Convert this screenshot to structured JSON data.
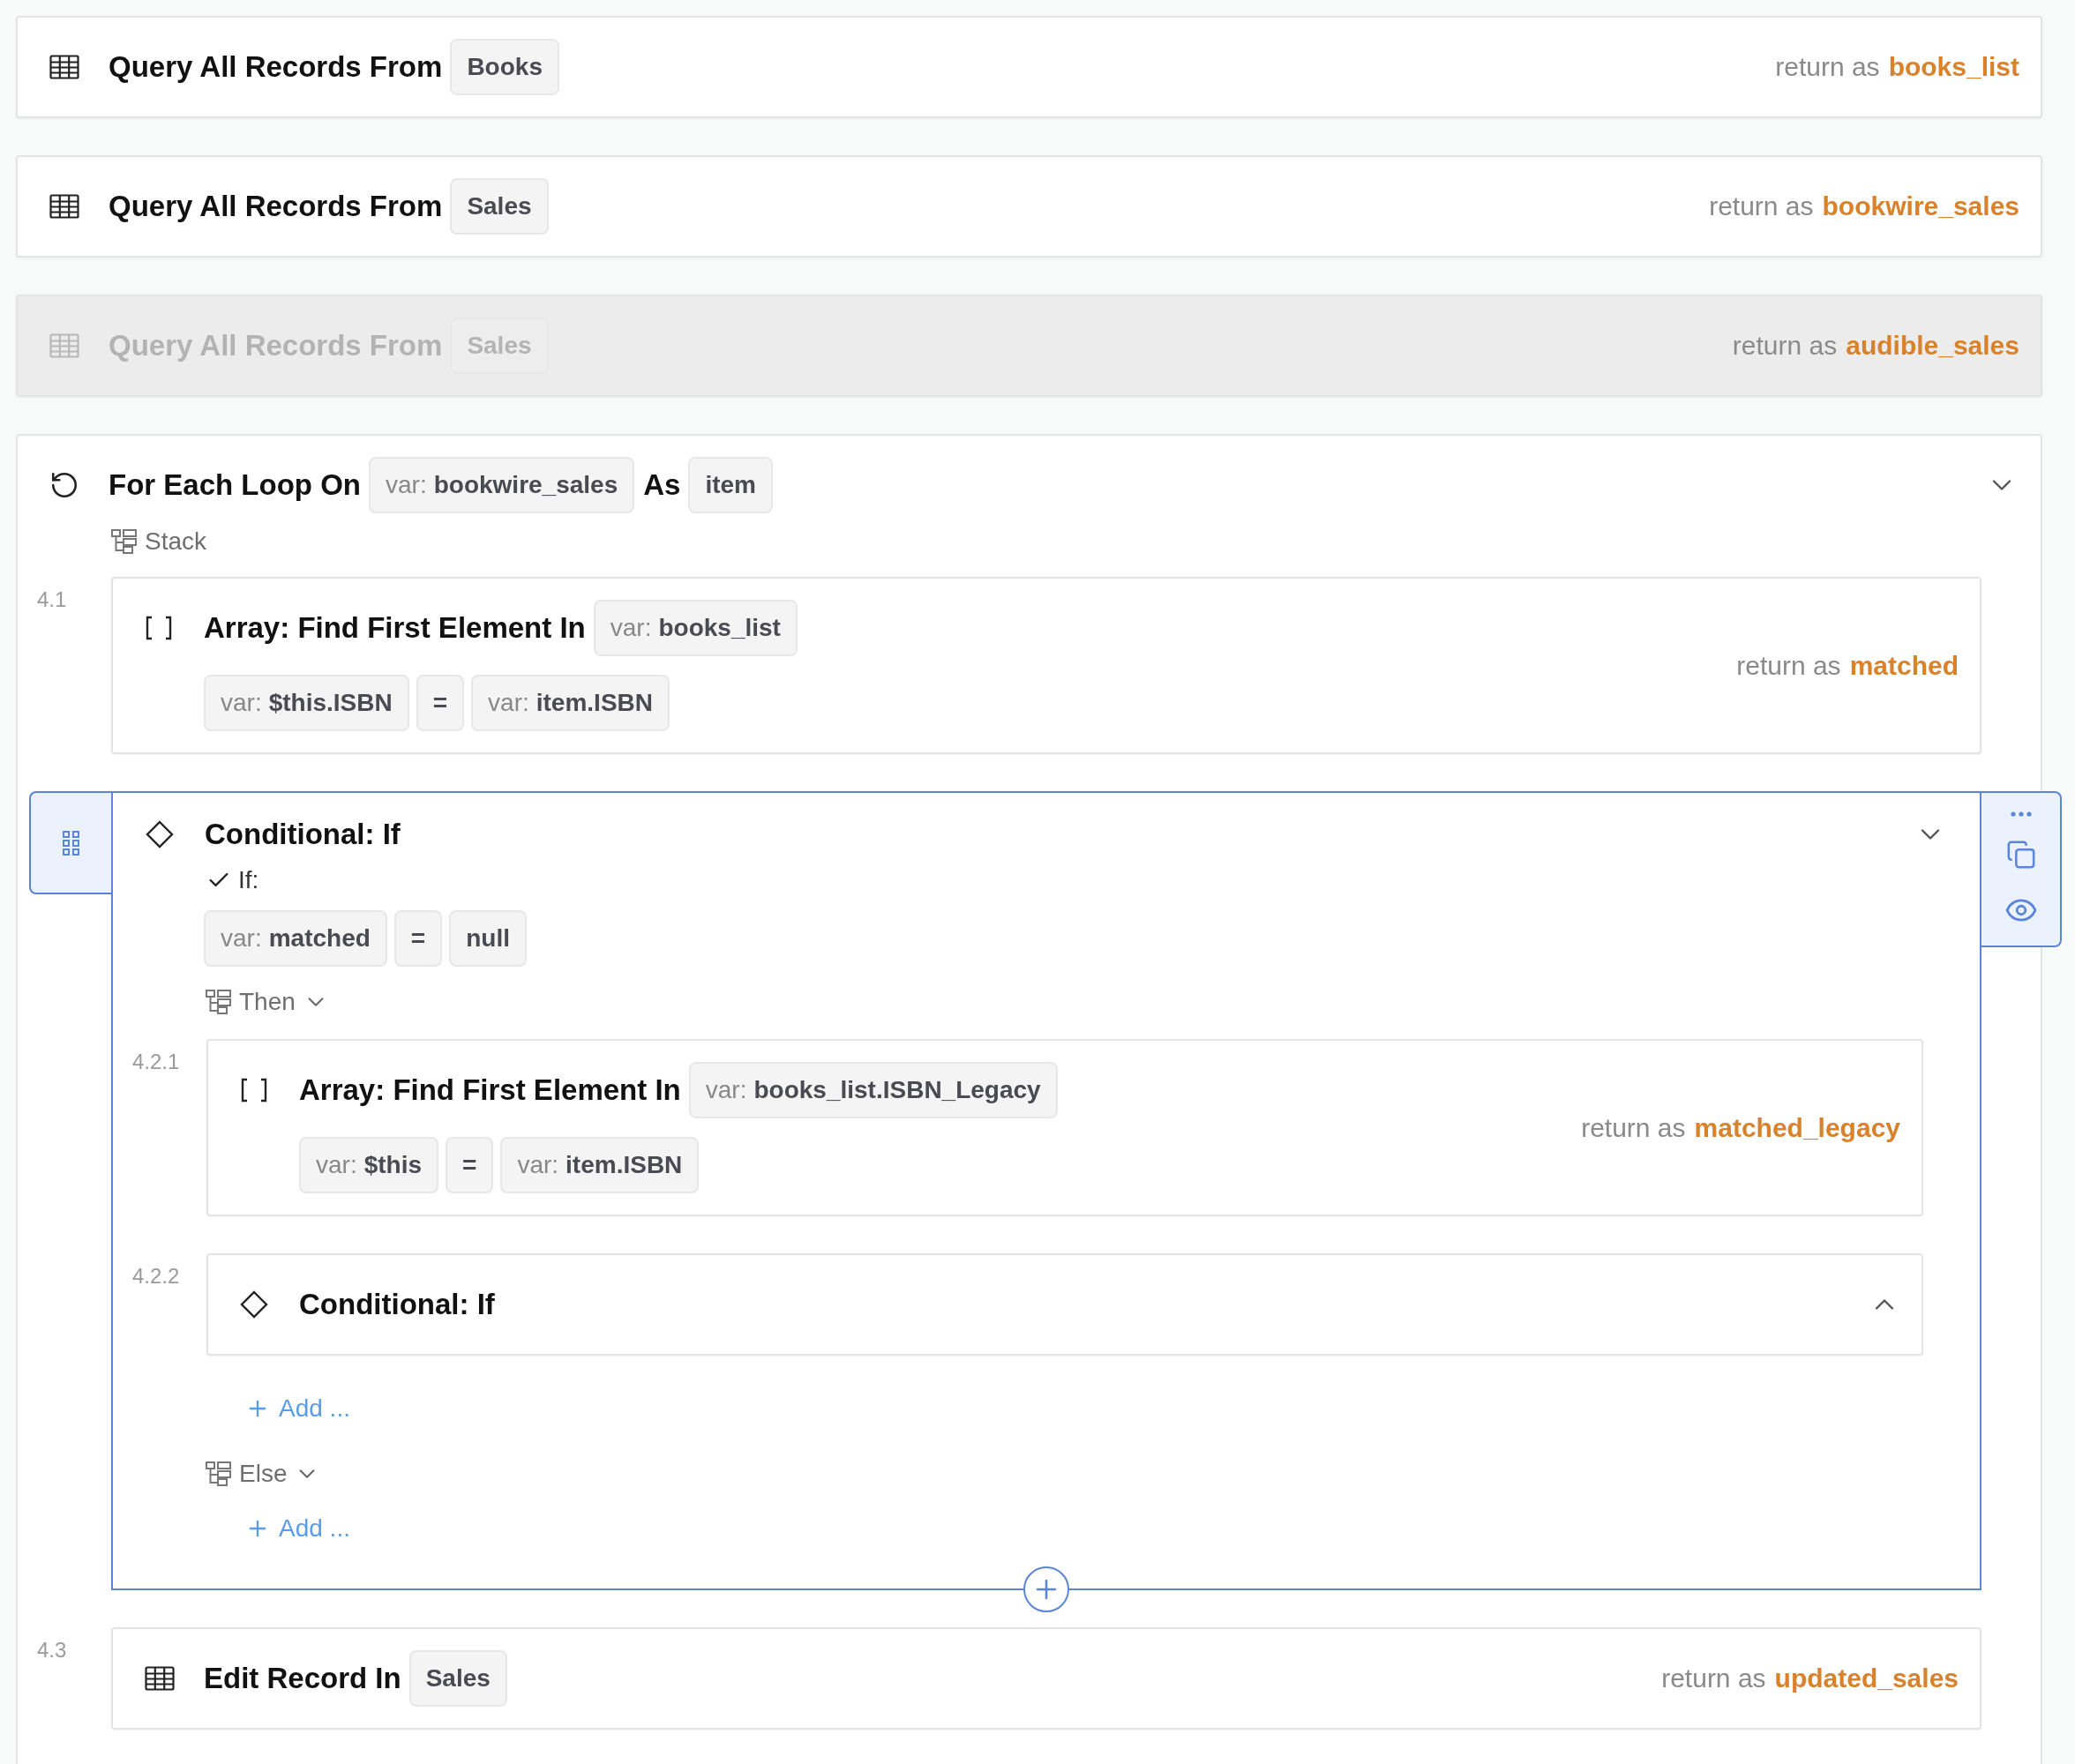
{
  "steps": [
    {
      "kind": "query",
      "disabled": false,
      "title": "Query All Records From",
      "source": {
        "text": "Books"
      },
      "return_label": "return as",
      "return_var": "books_list"
    },
    {
      "kind": "query",
      "disabled": false,
      "title": "Query All Records From",
      "source": {
        "text": "Sales"
      },
      "return_label": "return as",
      "return_var": "bookwire_sales"
    },
    {
      "kind": "query",
      "disabled": true,
      "title": "Query All Records From",
      "source": {
        "text": "Sales"
      },
      "return_label": "return as",
      "return_var": "audible_sales"
    },
    {
      "kind": "loop",
      "disabled": false,
      "expanded": true,
      "title": "For Each Loop On",
      "source": {
        "prefix": "var:",
        "text": "bookwire_sales"
      },
      "as_label": "As",
      "alias": {
        "text": "item"
      },
      "stack_label": "Stack",
      "children": [
        {
          "number": "4.1",
          "kind": "array_find",
          "selected": false,
          "title": "Array: Find First Element In",
          "source": {
            "prefix": "var:",
            "text": "books_list"
          },
          "condition": [
            {
              "prefix": "var:",
              "text": "$this.ISBN"
            },
            {
              "text": "="
            },
            {
              "prefix": "var:",
              "text": "item.ISBN"
            }
          ],
          "return_label": "return as",
          "return_var": "matched"
        },
        {
          "kind": "conditional",
          "selected": true,
          "expanded": true,
          "title": "Conditional: If",
          "if_label": "If:",
          "condition": [
            {
              "prefix": "var:",
              "text": "matched"
            },
            {
              "text": "="
            },
            {
              "text": "null"
            }
          ],
          "branches": [
            {
              "label": "Then",
              "add_label": "Add ...",
              "children": [
                {
                  "number": "4.2.1",
                  "kind": "array_find",
                  "selected": false,
                  "title": "Array: Find First Element In",
                  "source": {
                    "prefix": "var:",
                    "text": "books_list.ISBN_Legacy"
                  },
                  "condition": [
                    {
                      "prefix": "var:",
                      "text": "$this"
                    },
                    {
                      "text": "="
                    },
                    {
                      "prefix": "var:",
                      "text": "item.ISBN"
                    }
                  ],
                  "return_label": "return as",
                  "return_var": "matched_legacy"
                },
                {
                  "number": "4.2.2",
                  "kind": "conditional",
                  "selected": false,
                  "expanded": false,
                  "title": "Conditional: If"
                }
              ]
            },
            {
              "label": "Else",
              "add_label": "Add ..."
            }
          ]
        },
        {
          "number": "4.3",
          "kind": "edit",
          "selected": false,
          "title": "Edit Record In",
          "source": {
            "text": "Sales"
          },
          "return_label": "return as",
          "return_var": "updated_sales"
        }
      ]
    }
  ]
}
